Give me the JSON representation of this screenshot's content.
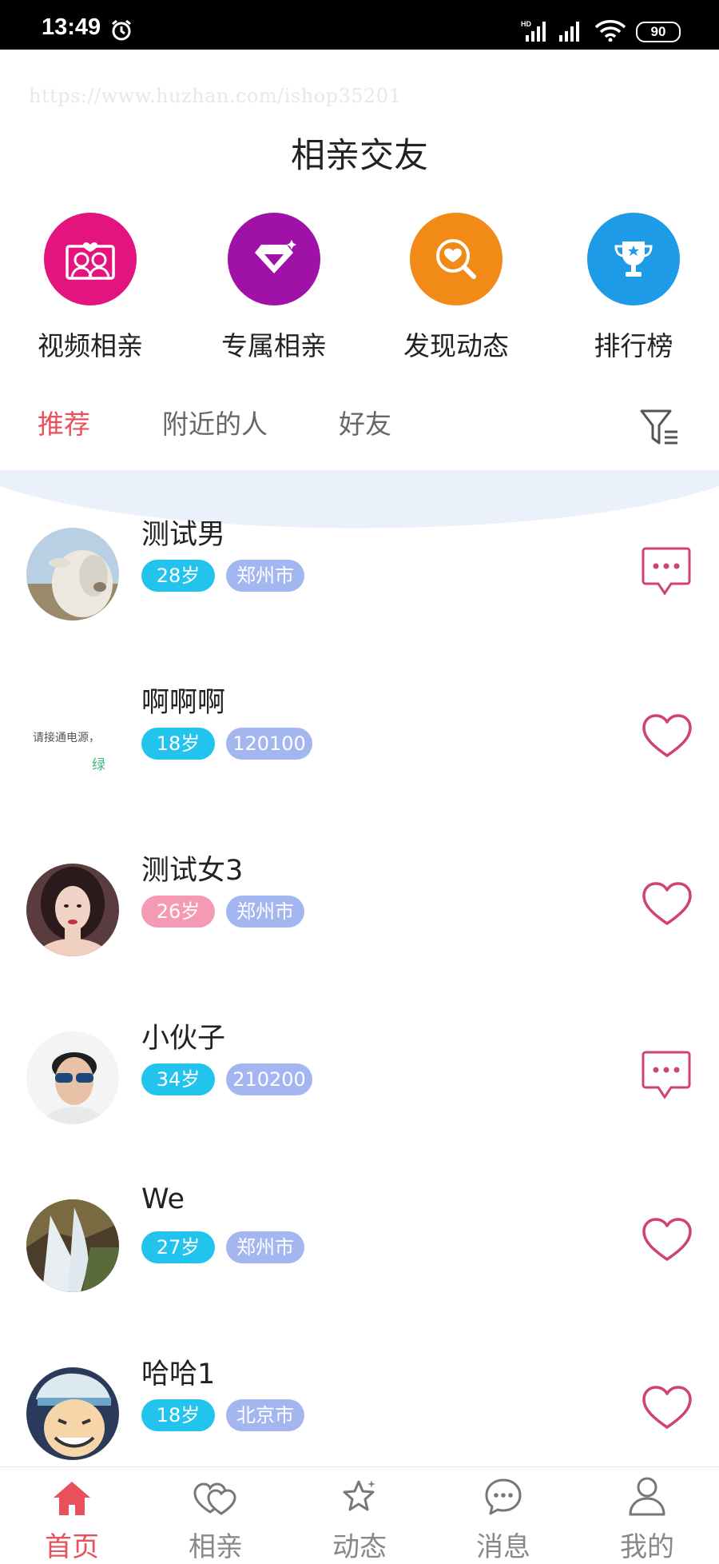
{
  "status_bar": {
    "time": "13:49",
    "battery": "90"
  },
  "watermark": "https://www.huzhan.com/ishop35201",
  "page_title": "相亲交友",
  "quick_actions": [
    {
      "label": "视频相亲",
      "icon": "video-couple-icon",
      "color": "#e4147f"
    },
    {
      "label": "专属相亲",
      "icon": "diamond-icon",
      "color": "#a011a8"
    },
    {
      "label": "发现动态",
      "icon": "search-heart-icon",
      "color": "#f28a18"
    },
    {
      "label": "排行榜",
      "icon": "trophy-icon",
      "color": "#1e9be6"
    }
  ],
  "tabs": [
    {
      "label": "推荐",
      "active": true
    },
    {
      "label": "附近的人",
      "active": false
    },
    {
      "label": "好友",
      "active": false
    }
  ],
  "users": [
    {
      "name": "测试男",
      "age": "28岁",
      "location": "郑州市",
      "gender": "male",
      "action": "message-icon",
      "avatar": "sheep-avatar"
    },
    {
      "name": "啊啊啊",
      "age": "18岁",
      "location": "120100",
      "gender": "male",
      "action": "heart-icon",
      "avatar": "text-avatar",
      "avatar_text": "请接通电源，",
      "avatar_text2": "绿"
    },
    {
      "name": "测试女3",
      "age": "26岁",
      "location": "郑州市",
      "gender": "female",
      "action": "heart-icon",
      "avatar": "woman-avatar"
    },
    {
      "name": "小伙子",
      "age": "34岁",
      "location": "210200",
      "gender": "male",
      "action": "message-icon",
      "avatar": "man-sunglasses-avatar"
    },
    {
      "name": "We",
      "age": "27岁",
      "location": "郑州市",
      "gender": "male",
      "action": "heart-icon",
      "avatar": "waterfall-avatar"
    },
    {
      "name": "哈哈1",
      "age": "18岁",
      "location": "北京市",
      "gender": "male",
      "action": "heart-icon",
      "avatar": "cartoon-avatar"
    }
  ],
  "bottom_nav": [
    {
      "label": "首页",
      "icon": "home-icon",
      "active": true
    },
    {
      "label": "相亲",
      "icon": "hearts-icon",
      "active": false
    },
    {
      "label": "动态",
      "icon": "star-icon",
      "active": false
    },
    {
      "label": "消息",
      "icon": "chat-icon",
      "active": false
    },
    {
      "label": "我的",
      "icon": "profile-icon",
      "active": false
    }
  ],
  "colors": {
    "accent": "#e8505b",
    "age_male": "#22c4ee",
    "age_female": "#f59ab5",
    "location": "#a3b6f0"
  }
}
